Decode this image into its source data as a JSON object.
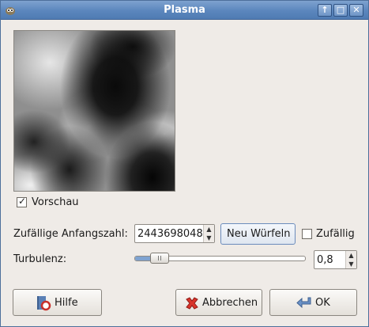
{
  "window": {
    "title": "Plasma",
    "icons": {
      "app": "gimp-wilber-icon",
      "controls": [
        "maximize-up-icon",
        "restore-icon",
        "close-icon"
      ]
    }
  },
  "preview": {
    "checkbox_checked": true,
    "label": "Vorschau"
  },
  "seed": {
    "label": "Zufällige Anfangszahl:",
    "value": "2443698048",
    "new_seed_button": "Neu Würfeln",
    "random_checkbox_checked": false,
    "random_label": "Zufällig"
  },
  "turbulence": {
    "label": "Turbulenz:",
    "value": "0,8",
    "min": 0.1,
    "max": 7.0
  },
  "buttons": {
    "help": "Hilfe",
    "cancel": "Abbrechen",
    "ok": "OK"
  },
  "colors": {
    "titlebar": "#5b86bd",
    "dialog_bg": "#efebe7",
    "slider_fill": "#7fa3d1"
  }
}
